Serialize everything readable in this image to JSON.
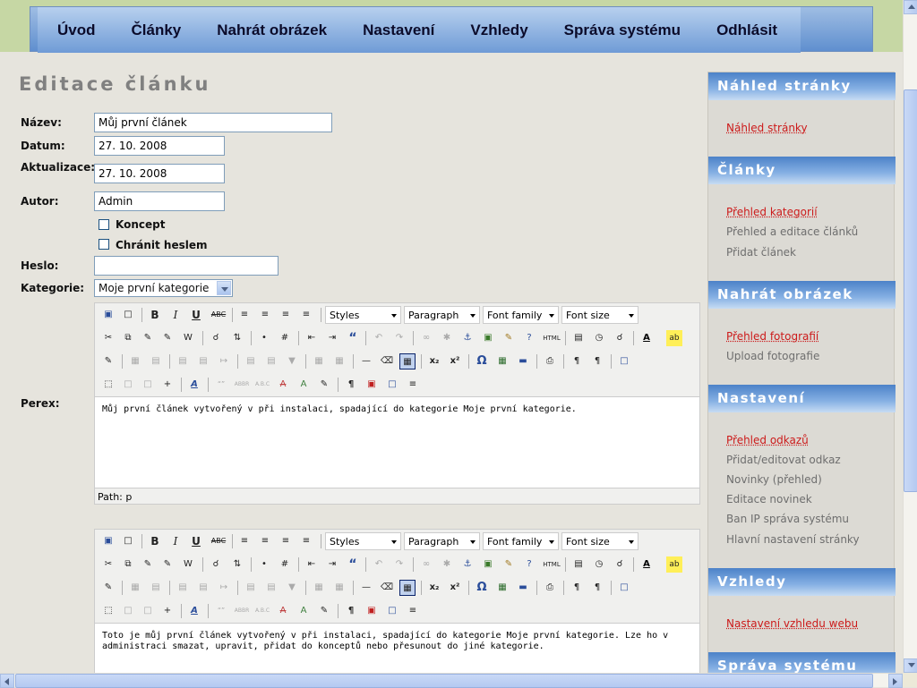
{
  "nav": {
    "items": [
      "Úvod",
      "Články",
      "Nahrát obrázek",
      "Nastavení",
      "Vzhledy",
      "Správa systému",
      "Odhlásit"
    ]
  },
  "page_title": "Editace článku",
  "form": {
    "name_label": "Název:",
    "name_value": "Můj první článek",
    "date_label": "Datum:",
    "date_value": "27. 10. 2008",
    "update_label": "Aktualizace:",
    "update_value": "27. 10. 2008",
    "author_label": "Autor:",
    "author_value": "Admin",
    "draft_label": "Koncept",
    "password_protect_label": "Chránit heslem",
    "password_label": "Heslo:",
    "password_value": "",
    "category_label": "Kategorie:",
    "category_value": "Moje první kategorie",
    "perex_label": "Perex:"
  },
  "editor": {
    "styles": "Styles",
    "paragraph": "Paragraph",
    "font_family": "Font family",
    "font_size": "Font size",
    "path_label": "Path: p"
  },
  "perex_text": "Můj první článek vytvořený v při instalaci, spadající do kategorie Moje první kategorie.",
  "body_text": "Toto je můj první článek vytvořený v při instalaci, spadající do kategorie Moje první kategorie. Lze ho v administraci smazat, upravit, přidat do konceptů nebo přesunout do jiné kategorie.",
  "sidebar": {
    "sections": [
      {
        "title": "Náhled stránky",
        "links": [
          {
            "text": "Náhled stránky",
            "active": true
          }
        ]
      },
      {
        "title": "Články",
        "links": [
          {
            "text": "Přehled kategorií",
            "active": true
          },
          {
            "text": "Přehled a editace článků",
            "active": false
          },
          {
            "text": "Přidat článek",
            "active": false
          }
        ]
      },
      {
        "title": "Nahrát obrázek",
        "links": [
          {
            "text": "Přehled fotografií",
            "active": true
          },
          {
            "text": "Upload fotografie",
            "active": false
          }
        ]
      },
      {
        "title": "Nastavení",
        "links": [
          {
            "text": "Přehled odkazů",
            "active": true
          },
          {
            "text": "Přidat/editovat odkaz",
            "active": false
          },
          {
            "text": "Novinky (přehled)",
            "active": false
          },
          {
            "text": "Editace novinek",
            "active": false
          },
          {
            "text": "Ban IP správa systému",
            "active": false
          },
          {
            "text": "Hlavní nastavení stránky",
            "active": false
          }
        ]
      },
      {
        "title": "Vzhledy",
        "links": [
          {
            "text": "Nastavení vzhledu webu",
            "active": true
          }
        ]
      },
      {
        "title": "Správa systému",
        "links": []
      }
    ]
  }
}
